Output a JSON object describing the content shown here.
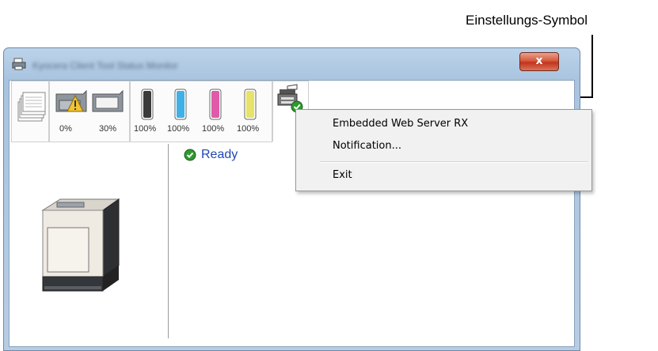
{
  "callout": {
    "label": "Einstellungs-Symbol"
  },
  "window": {
    "title": "Kyocera Client Tool Status Monitor",
    "close_label": "x"
  },
  "toolbar": {
    "tiles": [
      {
        "name": "paper-stack",
        "labels": []
      },
      {
        "name": "paper-trays",
        "labels": [
          "0%",
          "30%"
        ]
      },
      {
        "name": "toner",
        "labels": [
          "100%",
          "100%",
          "100%",
          "100%"
        ]
      },
      {
        "name": "device-status",
        "labels": []
      }
    ],
    "toner_colors": [
      "#3a3a3a",
      "#3fb1e6",
      "#e05aa8",
      "#e6e26a"
    ]
  },
  "status": {
    "text": "Ready",
    "icon": "checkmark-icon"
  },
  "menu": {
    "items": [
      "Embedded Web Server RX",
      "Notification...",
      "Exit"
    ]
  }
}
